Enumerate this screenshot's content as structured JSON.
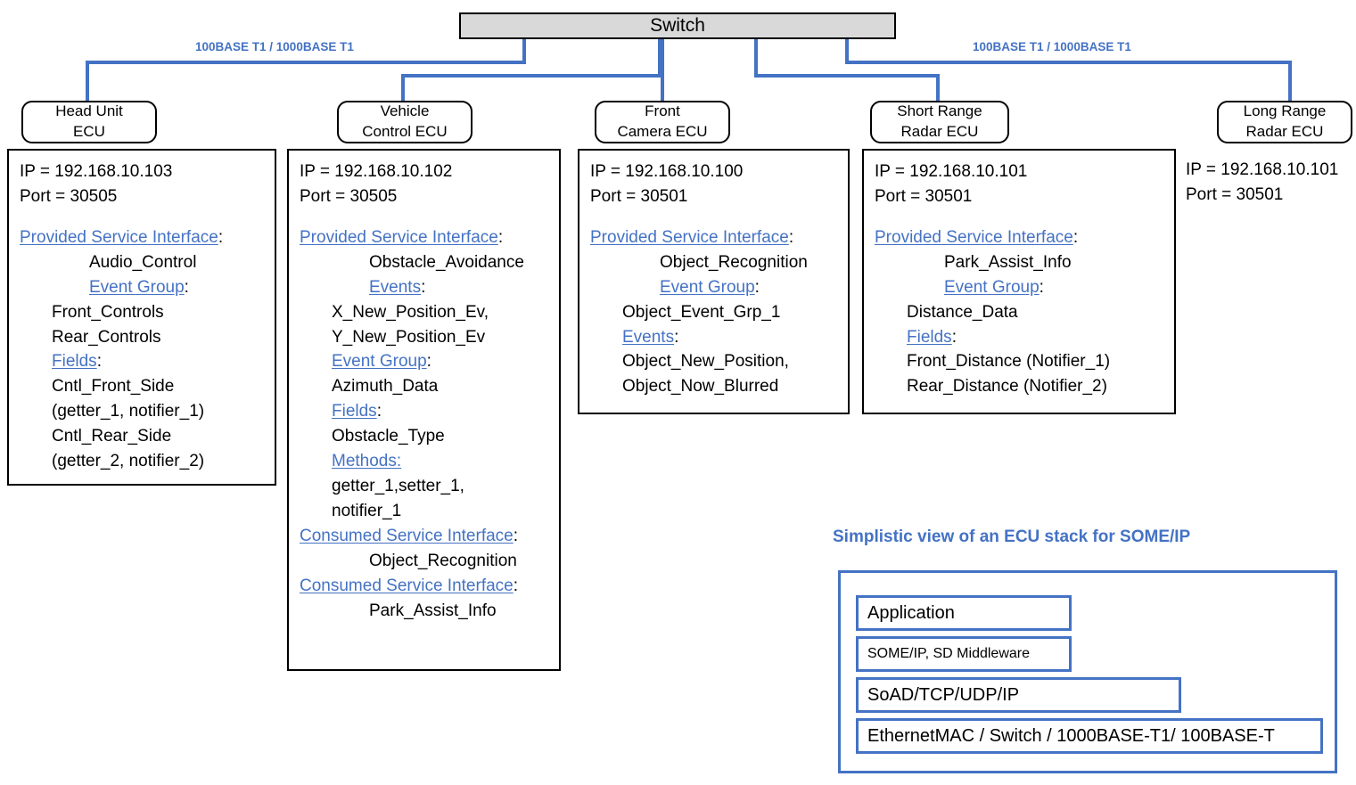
{
  "switch": {
    "label": "Switch"
  },
  "link_labels": [
    {
      "text": "100BASE T1 / 1000BASE T1"
    },
    {
      "text": "100BASE T1 / 1000BASE T1"
    }
  ],
  "ecus": [
    {
      "name": "head-unit",
      "title_line1": "Head Unit",
      "title_line2": "ECU"
    },
    {
      "name": "vehicle-control",
      "title_line1": "Vehicle",
      "title_line2": "Control ECU"
    },
    {
      "name": "front-camera",
      "title_line1": "Front",
      "title_line2": "Camera ECU"
    },
    {
      "name": "short-range-radar",
      "title_line1": "Short Range",
      "title_line2": "Radar ECU"
    },
    {
      "name": "long-range-radar",
      "title_line1": "Long Range",
      "title_line2": "Radar ECU"
    }
  ],
  "details": {
    "head_unit": {
      "ip": "IP = 192.168.10.103",
      "port": "Port = 30505",
      "l1": "Provided Service Interface",
      "l2": "Audio_Control",
      "l3": "Event Group",
      "l4": "Front_Controls",
      "l5": "Rear_Controls",
      "l6": "Fields",
      "l7": "Cntl_Front_Side",
      "l8": "(getter_1, notifier_1)",
      "l9": "Cntl_Rear_Side",
      "l10": "(getter_2, notifier_2)",
      "colon": ":"
    },
    "vehicle_control": {
      "ip": "IP = 192.168.10.102",
      "port": "Port = 30505",
      "l1": "Provided Service Interface",
      "l2": "Obstacle_Avoidance",
      "l3": "Events",
      "l4": "X_New_Position_Ev,",
      "l5": "Y_New_Position_Ev",
      "l6": "Event Group",
      "l7": "Azimuth_Data",
      "l8": "Fields",
      "l9": "Obstacle_Type",
      "l10": "Methods:",
      "l11": "getter_1,setter_1,",
      "l12": "notifier_1",
      "l13": "Consumed Service Interface",
      "l14": "Object_Recognition",
      "l15": "Consumed Service Interface",
      "l16": "Park_Assist_Info",
      "colon": ":"
    },
    "front_camera": {
      "ip": "IP = 192.168.10.100",
      "port": "Port = 30501",
      "l1": "Provided Service Interface",
      "l2": "Object_Recognition",
      "l3": "Event Group",
      "l4": "Object_Event_Grp_1",
      "l5": "Events",
      "l6": "Object_New_Position,",
      "l7": "Object_Now_Blurred",
      "colon": ":"
    },
    "short_range_radar": {
      "ip": "IP = 192.168.10.101",
      "port": "Port = 30501",
      "l1": "Provided Service Interface",
      "l2": "Park_Assist_Info",
      "l3": "Event Group",
      "l4": "Distance_Data",
      "l5": "Fields",
      "l6": "Front_Distance (Notifier_1)",
      "l7": "Rear_Distance (Notifier_2)",
      "colon": ":"
    },
    "long_range_radar": {
      "ip": "IP = 192.168.10.101",
      "port": "Port = 30501"
    }
  },
  "stack": {
    "title": "Simplistic view of an ECU stack for SOME/IP",
    "layers": [
      {
        "label": "Application",
        "font_size": "20px"
      },
      {
        "label": "SOME/IP, SD Middleware",
        "font_size": "16px"
      },
      {
        "label": "SoAD/TCP/UDP/IP",
        "font_size": "20px"
      },
      {
        "label": "EthernetMAC / Switch / 1000BASE-T1/ 100BASE-T",
        "font_size": "20px"
      }
    ]
  },
  "colors": {
    "accent_blue": "#4472C4",
    "switch_fill": "#D9D9D9",
    "outline_black": "#000000"
  }
}
